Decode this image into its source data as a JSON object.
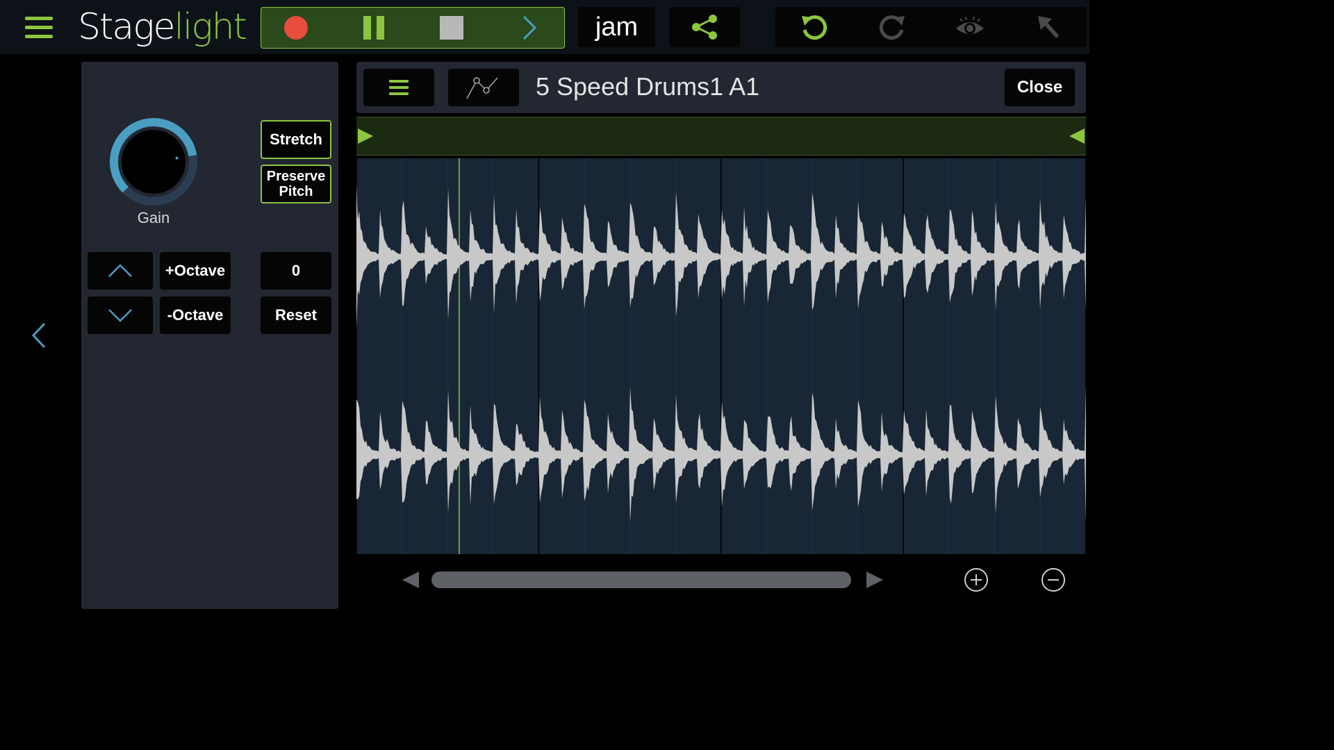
{
  "app": {
    "logo_part1": "Stage",
    "logo_part2": "light"
  },
  "toolbar": {
    "jam_label": "jam",
    "icons": [
      "menu-icon",
      "record-icon",
      "pause-icon",
      "stop-icon",
      "chevron-right-icon",
      "share-icon",
      "undo-icon",
      "redo-icon",
      "eye-icon",
      "cursor-arrow-icon"
    ]
  },
  "colors": {
    "accent_green": "#8cc63f",
    "record_red": "#e74c3c",
    "knob_blue": "#4a9ec2",
    "waveform": "#c8c8c8"
  },
  "left_panel": {
    "gain_label": "Gain",
    "gain_level": 0.8,
    "stretch_label": "Stretch",
    "preserve_label_line1": "Preserve",
    "preserve_label_line2": "Pitch",
    "plus_octave_label": "+Octave",
    "minus_octave_label": "-Octave",
    "pitch_value": "0",
    "reset_label": "Reset"
  },
  "editor": {
    "clip_title": "5 Speed Drums1 A1",
    "close_label": "Close"
  },
  "scroll": {
    "thumb_start": 0.02,
    "thumb_end": 0.98
  }
}
